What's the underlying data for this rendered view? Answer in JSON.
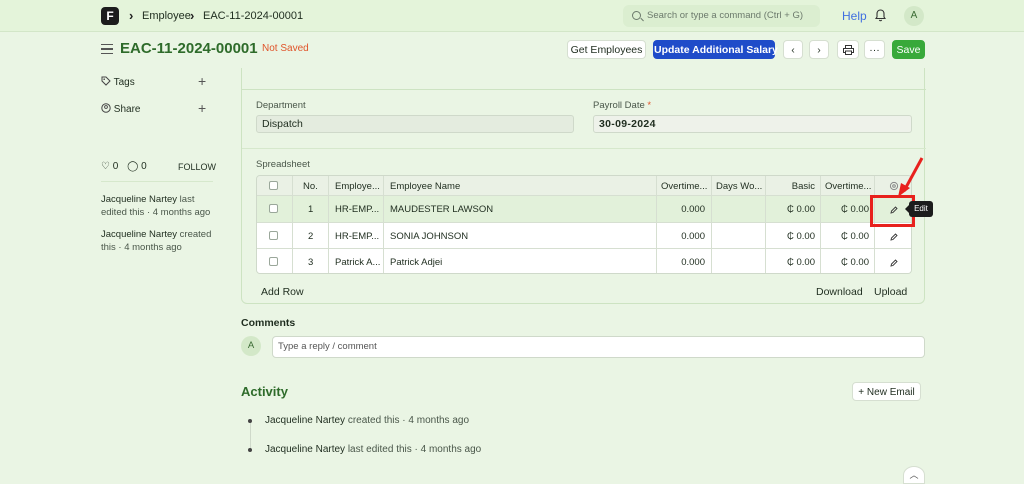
{
  "navbar": {
    "logo_letter": "F",
    "breadcrumbs": [
      "Employee",
      "EAC-11-2024-00001"
    ],
    "search_placeholder": "Search or type a command (Ctrl + G)",
    "help_label": "Help",
    "avatar_initial": "A"
  },
  "header": {
    "title": "EAC-11-2024-00001",
    "status": "Not Saved",
    "get_employees_label": "Get Employees",
    "update_salary_label": "Update Additional Salary",
    "more_label": "···",
    "save_label": "Save"
  },
  "sidebar": {
    "tags_label": "Tags",
    "share_label": "Share",
    "likes_count": "0",
    "comments_count": "0",
    "follow_label": "FOLLOW",
    "edited_user": "Jacqueline Nartey",
    "edited_suffix": " last edited this · 4 months ago",
    "created_user": "Jacqueline Nartey",
    "created_suffix": " created this · 4 months ago"
  },
  "form": {
    "department_label": "Department",
    "department_value": "Dispatch",
    "payroll_date_label": "Payroll Date",
    "payroll_date_required": "*",
    "payroll_date_value": "30-09-2024",
    "spreadsheet_label": "Spreadsheet"
  },
  "table": {
    "headers": [
      "No.",
      "Employe...",
      "Employee Name",
      "Overtime...",
      "Days Wo...",
      "Basic",
      "Overtime..."
    ],
    "rows": [
      {
        "no": "1",
        "employee": "HR-EMP...",
        "name": "MAUDESTER LAWSON",
        "overtime": "0.000",
        "days": "",
        "basic": "₵ 0.00",
        "overtime2": "₵ 0.00"
      },
      {
        "no": "2",
        "employee": "HR-EMP...",
        "name": "SONIA JOHNSON",
        "overtime": "0.000",
        "days": "",
        "basic": "₵ 0.00",
        "overtime2": "₵ 0.00"
      },
      {
        "no": "3",
        "employee": "Patrick A...",
        "name": "Patrick Adjei",
        "overtime": "0.000",
        "days": "",
        "basic": "₵ 0.00",
        "overtime2": "₵ 0.00"
      }
    ],
    "add_row_label": "Add Row",
    "download_label": "Download",
    "upload_label": "Upload",
    "tooltip": "Edit"
  },
  "comments": {
    "title": "Comments",
    "avatar_initial": "A",
    "placeholder": "Type a reply / comment"
  },
  "activity": {
    "title": "Activity",
    "new_email_label": "+ New Email",
    "items": [
      {
        "user": "Jacqueline Nartey",
        "text": " created this · 4 months ago"
      },
      {
        "user": "Jacqueline Nartey",
        "text": " last edited this · 4 months ago"
      }
    ]
  },
  "colors": {
    "accent": "#2e6b2a",
    "primary_button": "#1f4cc9",
    "save_button": "#38a93a",
    "not_saved": "#e0542a",
    "annotation": "#e8211d"
  }
}
